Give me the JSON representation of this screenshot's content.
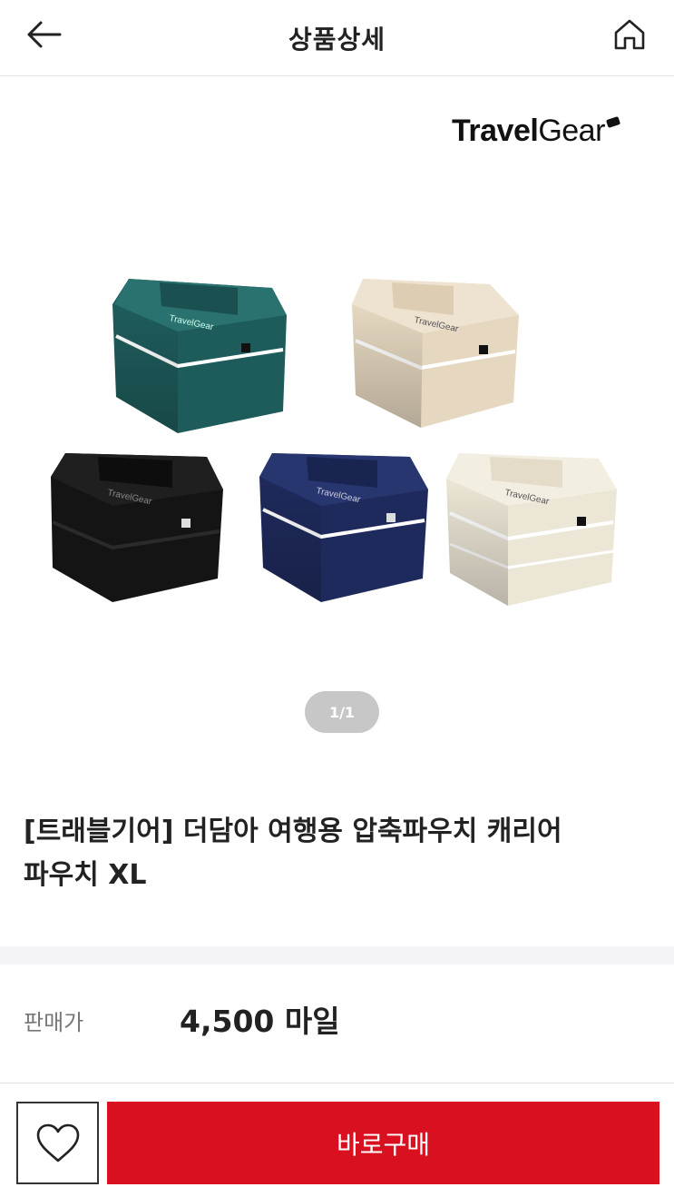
{
  "header": {
    "title": "상품상세",
    "back_icon": "arrow-left-icon",
    "home_icon": "home-icon"
  },
  "product": {
    "brand_logo_bold": "Travel",
    "brand_logo_light": "Gear",
    "image_pager": "1/1",
    "name_line1": "[트래블기어] 더담아 여행용 압축파우치 캐리어",
    "name_line2": "파우치 XL",
    "pouch_colors": [
      "#1e5c5b",
      "#e6d8c0",
      "#141414",
      "#1f2a5c",
      "#ece6d6"
    ],
    "pouch_brand_print": "TravelGear"
  },
  "price": {
    "label": "판매가",
    "value": "4,500 마일"
  },
  "actions": {
    "wish_icon": "heart-icon",
    "buy_label": "바로구매"
  },
  "colors": {
    "accent": "#d9101f",
    "pager_bg": "#c7c7c7"
  }
}
